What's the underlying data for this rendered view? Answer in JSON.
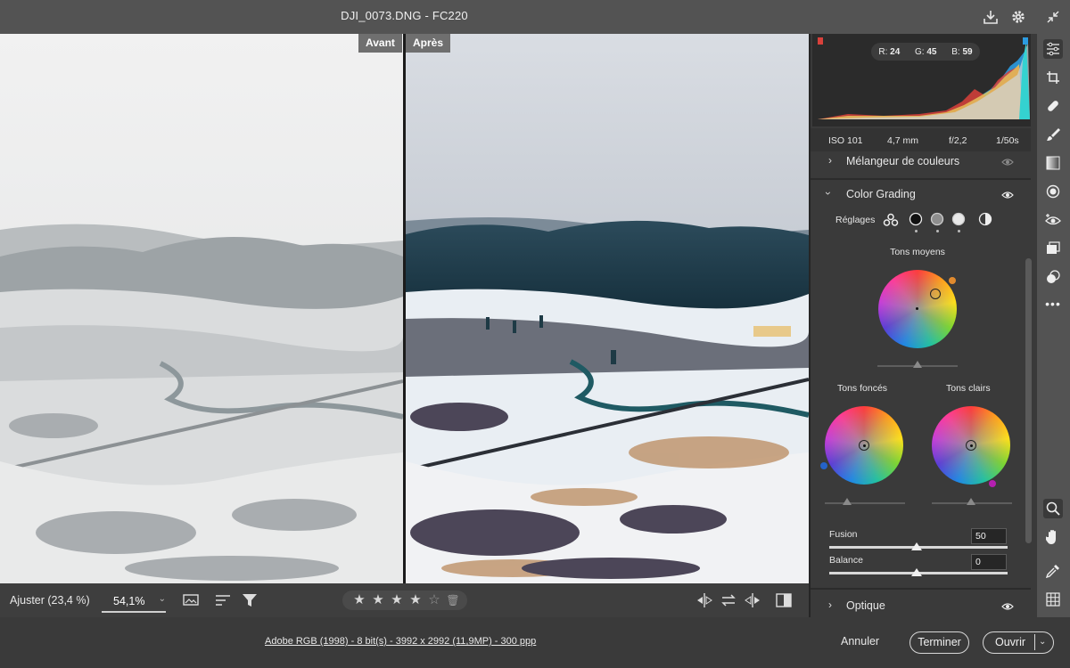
{
  "window": {
    "title": "DJI_0073.DNG  -  FC220"
  },
  "compare": {
    "before_label": "Avant",
    "after_label": "Après"
  },
  "viewer_bar": {
    "zoom_fit_label": "Ajuster (23,4 %)",
    "zoom_value": "54,1%",
    "rating": 4,
    "rating_max": 5
  },
  "histogram": {
    "r_label": "R:",
    "r": "24",
    "g_label": "G:",
    "g": "45",
    "b_label": "B:",
    "b": "59"
  },
  "exif": {
    "iso": "ISO 101",
    "focal": "4,7 mm",
    "aperture": "f/2,2",
    "shutter": "1/50s"
  },
  "sections": {
    "color_mixer": "Mélangeur de couleurs",
    "color_grading": "Color Grading",
    "optics": "Optique"
  },
  "grading": {
    "adjust_label": "Réglages",
    "midtones": "Tons moyens",
    "shadows": "Tons foncés",
    "highlights": "Tons clairs",
    "blending_label": "Fusion",
    "blending_value": "50",
    "balance_label": "Balance",
    "balance_value": "0"
  },
  "footer": {
    "info": "Adobe RGB (1998) - 8 bit(s) - 3992 x 2992 (11,9MP) - 300 ppp",
    "cancel": "Annuler",
    "done": "Terminer",
    "open": "Ouvrir"
  },
  "colors": {
    "accent_red": "#d9413b",
    "accent_blue": "#2c9be0"
  }
}
